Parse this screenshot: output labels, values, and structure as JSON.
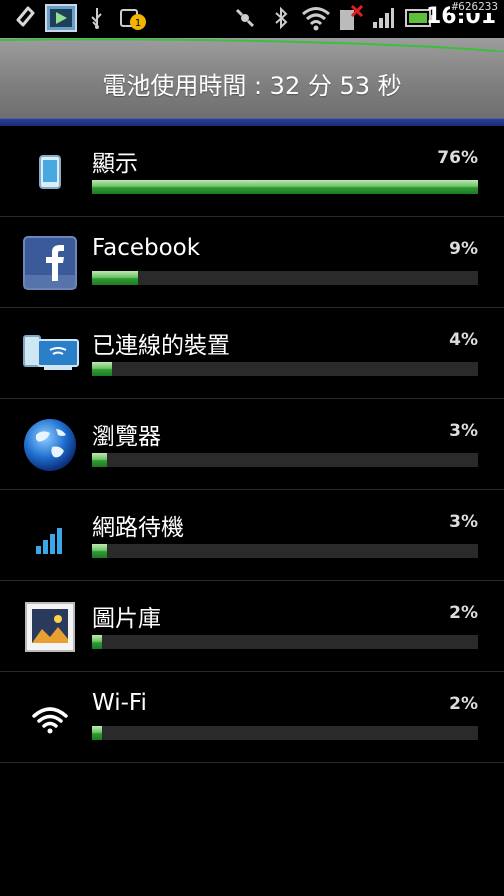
{
  "status_bar": {
    "time": "16:01",
    "watermark": "#626233",
    "icons": [
      "link-icon",
      "media-icon",
      "usb-icon",
      "notification-icon",
      "satellite-icon",
      "bluetooth-icon",
      "wifi-icon",
      "sim-error-icon",
      "signal-icon",
      "battery-icon"
    ]
  },
  "header": {
    "title": "電池使用時間 : 32 分 53 秒"
  },
  "colors": {
    "bar_fill": "#4caf50",
    "bar_track": "#2a2a2a",
    "header_bg": "#8a8a8a",
    "divider": "#1f2f80"
  },
  "items": [
    {
      "label": "顯示",
      "percent_text": "76%",
      "fraction": 0.76,
      "icon": "phone-display-icon"
    },
    {
      "label": "Facebook",
      "percent_text": "9%",
      "fraction": 0.09,
      "icon": "facebook-icon"
    },
    {
      "label": "已連線的裝置",
      "percent_text": "4%",
      "fraction": 0.04,
      "icon": "connected-devices-icon"
    },
    {
      "label": "瀏覽器",
      "percent_text": "3%",
      "fraction": 0.03,
      "icon": "browser-globe-icon"
    },
    {
      "label": "網路待機",
      "percent_text": "3%",
      "fraction": 0.03,
      "icon": "network-standby-icon"
    },
    {
      "label": "圖片庫",
      "percent_text": "2%",
      "fraction": 0.02,
      "icon": "gallery-icon"
    },
    {
      "label": "Wi-Fi",
      "percent_text": "2%",
      "fraction": 0.02,
      "icon": "wifi-icon"
    }
  ]
}
